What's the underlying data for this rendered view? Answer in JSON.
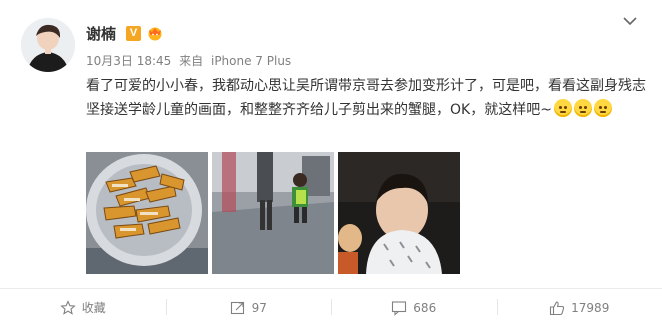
{
  "user": {
    "name": "谢楠",
    "verified_badge": "V",
    "avatar_icon": "avatar"
  },
  "meta": {
    "date": "10月3日 18:45",
    "from_label": "来自",
    "source": "iPhone 7 Plus"
  },
  "post": {
    "text": "看了可爱的小小春，我都动心思让吴所谓带京哥去参加变形计了，可是吧，看看这副身残志坚接送学龄儿童的画面，和整整齐齐给儿子剪出来的蟹腿，OK，就这样吧~",
    "emojis": [
      "sleepy-face-emoji",
      "smile-face-emoji",
      "smile-face-emoji"
    ]
  },
  "photos": [
    {
      "name": "photo-crab-legs-bowl"
    },
    {
      "name": "photo-walking-child"
    },
    {
      "name": "photo-boy-eating"
    }
  ],
  "actions": {
    "favorite_label": "收藏",
    "repost_count": "97",
    "comment_count": "686",
    "like_count": "17989"
  },
  "colors": {
    "accent_badge": "#f5a623",
    "muted_text": "#808080",
    "divider": "#ebebeb"
  }
}
